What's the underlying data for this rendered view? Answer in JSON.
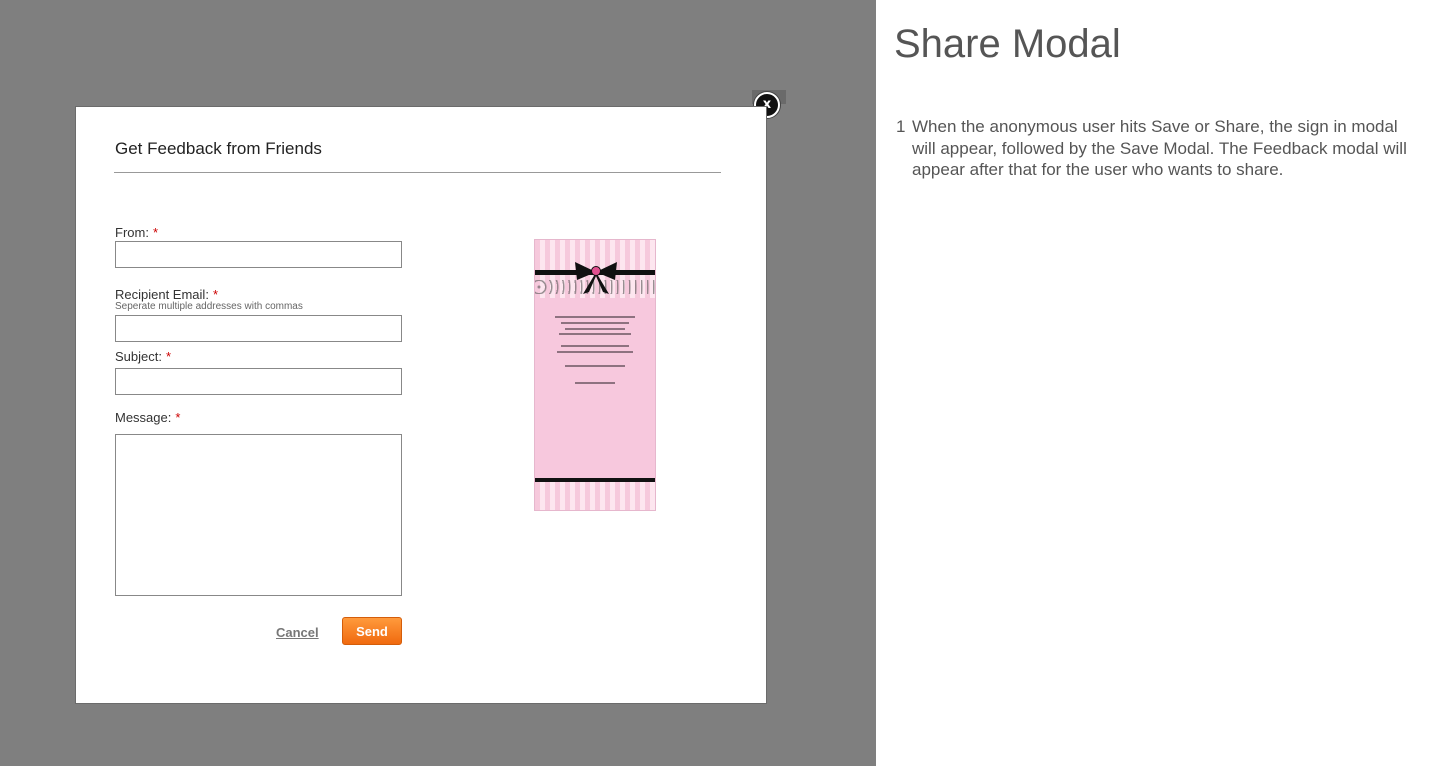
{
  "modal": {
    "title": "Get Feedback from Friends",
    "close_label": "x",
    "fields": {
      "from": {
        "label": "From:",
        "required_mark": "*",
        "value": ""
      },
      "recipient": {
        "label": "Recipient Email:",
        "required_mark": "*",
        "hint": "Seperate multiple addresses with commas",
        "value": ""
      },
      "subject": {
        "label": "Subject:",
        "required_mark": "*",
        "value": ""
      },
      "message": {
        "label": "Message:",
        "required_mark": "*",
        "value": ""
      }
    },
    "cancel_label": "Cancel",
    "send_label": "Send"
  },
  "notes": {
    "title": "Share Modal",
    "items": [
      {
        "number": "1",
        "text": "When the anonymous user hits Save or Share, the sign in modal will appear, followed by the Save Modal. The Feedback modal will appear after that for the user who wants to share."
      }
    ]
  },
  "colors": {
    "overlay": "#7f7f7f",
    "send_button": "#f27a1f",
    "required": "#cc0000",
    "card_pink": "#f7c8dd"
  }
}
